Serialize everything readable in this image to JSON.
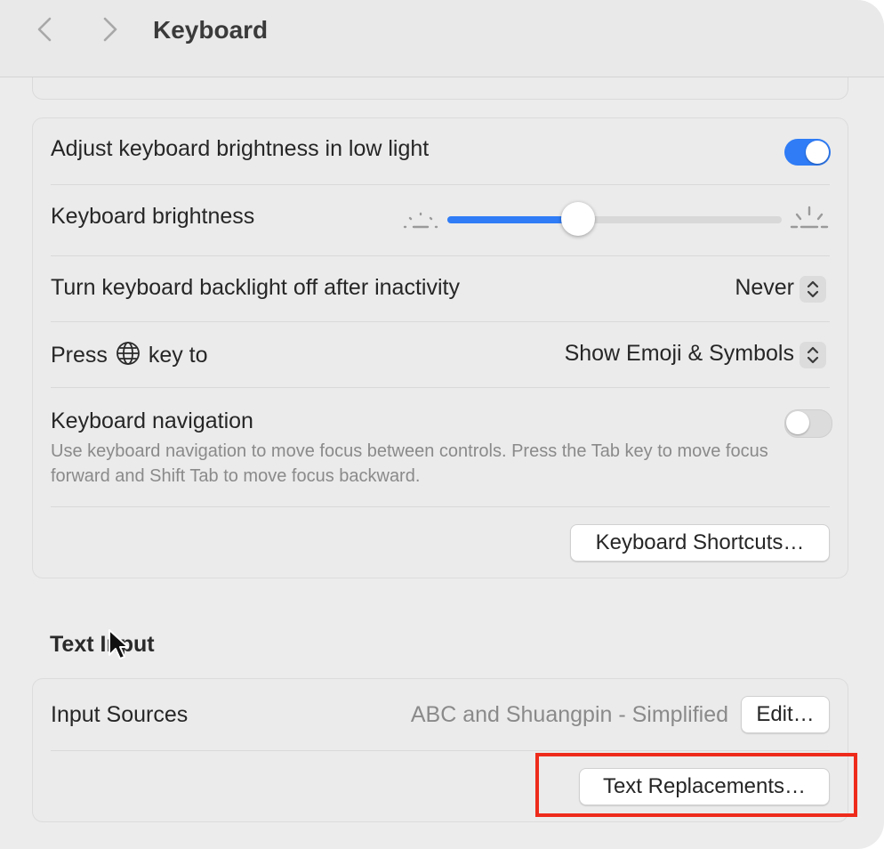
{
  "window": {
    "title": "Keyboard"
  },
  "brightness_card": {
    "auto_brightness": {
      "label": "Adjust keyboard brightness in low light",
      "enabled": true
    },
    "keyboard_brightness": {
      "label": "Keyboard brightness",
      "level": 0.39
    },
    "backlight_off": {
      "label": "Turn keyboard backlight off after inactivity",
      "value": "Never"
    },
    "globe_key": {
      "label_before": "Press",
      "label_after": "key to",
      "value": "Show Emoji & Symbols"
    },
    "keyboard_navigation": {
      "label": "Keyboard navigation",
      "description": "Use keyboard navigation to move focus between controls. Press the Tab key to move focus forward and Shift Tab to move focus backward.",
      "enabled": false
    },
    "shortcuts_button": "Keyboard Shortcuts…"
  },
  "text_input": {
    "section_title": "Text Input",
    "input_sources": {
      "label": "Input Sources",
      "value": "ABC and Shuangpin - Simplified",
      "edit_button": "Edit…"
    },
    "text_replacements_button": "Text Replacements…"
  },
  "colors": {
    "accent": "#2f7cf6",
    "highlight": "#ee2b1b"
  }
}
